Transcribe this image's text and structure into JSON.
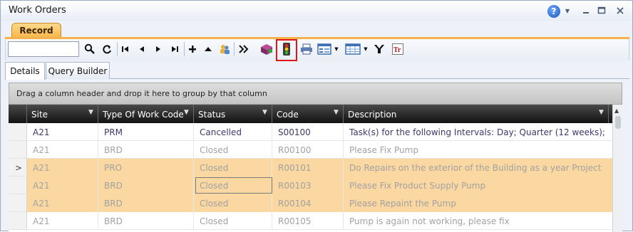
{
  "window": {
    "title": "Work Orders"
  },
  "record_tab": {
    "label": "Record"
  },
  "toolbar": {
    "search_value": ""
  },
  "subtabs": [
    "Details",
    "Query Builder"
  ],
  "group_panel": {
    "text": "Drag a column header and drop it here to group by that column"
  },
  "grid": {
    "columns": [
      "Site",
      "Type Of Work Code",
      "Status",
      "Code",
      "Description"
    ],
    "rows": [
      {
        "site": "A21",
        "type": "PRM",
        "status": "Cancelled",
        "code": "S00100",
        "description": "Task(s) for the following Intervals: Day;  Quarter (12 weeks);"
      },
      {
        "site": "A21",
        "type": "BRD",
        "status": "Closed",
        "code": "R00100",
        "description": "Please Fix Pump"
      },
      {
        "site": "A21",
        "type": "PRO",
        "status": "Closed",
        "code": "R00101",
        "description": "Do Repairs on the exterior of the Building as a year Project"
      },
      {
        "site": "A21",
        "type": "BRD",
        "status": "Closed",
        "code": "R00103",
        "description": "Please Fix Product Supply Pump"
      },
      {
        "site": "A21",
        "type": "BRD",
        "status": "Closed",
        "code": "R00104",
        "description": "Please Repaint the Pump"
      },
      {
        "site": "A21",
        "type": "BRD",
        "status": "Closed",
        "code": "R00105",
        "description": "Pump is again not working, please fix"
      }
    ]
  },
  "colors": {
    "accent": "#f6b24a",
    "highlight_row": "#fbd7a1",
    "header_dark": "#121212",
    "red_box": "#e0141b"
  }
}
